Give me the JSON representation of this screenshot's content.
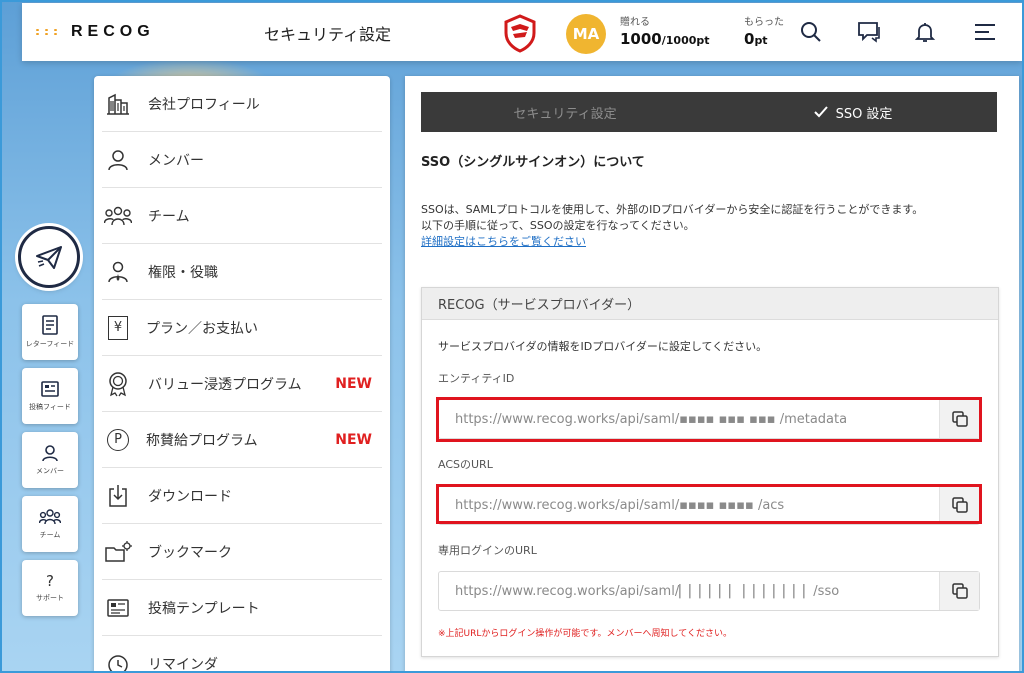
{
  "header": {
    "logo_text": "RECOG",
    "title": "セキュリティ設定",
    "avatar_initials": "MA",
    "give": {
      "label": "贈れる",
      "value": "1000",
      "suffix": "/1000pt"
    },
    "receive": {
      "label": "もらった",
      "value": "0",
      "suffix": "pt"
    }
  },
  "rail": {
    "letter_feed": "レターフィード",
    "post_feed": "投稿フィード",
    "member": "メンバー",
    "team": "チーム",
    "support": "サポート",
    "support_glyph": "?"
  },
  "menu": {
    "items": [
      {
        "label": "会社プロフィール",
        "icon": "building-icon"
      },
      {
        "label": "メンバー",
        "icon": "person-icon"
      },
      {
        "label": "チーム",
        "icon": "team-icon"
      },
      {
        "label": "権限・役職",
        "icon": "role-icon"
      },
      {
        "label": "プラン／お支払い",
        "icon": "yen-icon"
      },
      {
        "label": "バリュー浸透プログラム",
        "icon": "badge-icon",
        "badge": "NEW"
      },
      {
        "label": "称賛給プログラム",
        "icon": "p-coin-icon",
        "badge": "NEW"
      },
      {
        "label": "ダウンロード",
        "icon": "download-icon"
      },
      {
        "label": "ブックマーク",
        "icon": "bookmark-folder-icon"
      },
      {
        "label": "投稿テンプレート",
        "icon": "template-icon"
      },
      {
        "label": "リマインダ",
        "icon": "clock-icon"
      }
    ],
    "p_glyph": "P",
    "yen_glyph": "¥"
  },
  "tabs": [
    {
      "label": "セキュリティ設定",
      "active": false
    },
    {
      "label": "SSO 設定",
      "active": true
    }
  ],
  "sso": {
    "title": "SSO（シングルサインオン）について",
    "desc_line1": "SSOは、SAMLプロトコルを使用して、外部のIDプロバイダーから安全に認証を行うことができます。",
    "desc_line2": "以下の手順に従って、SSOの設定を行なってください。",
    "detail_link": "詳細設定はこちらをご覧ください"
  },
  "provider": {
    "title": "RECOG（サービスプロバイダー）",
    "intro": "サービスプロバイダの情報をIDプロバイダーに設定してください。",
    "fields": [
      {
        "label": "エンティティID",
        "value": "https://www.recog.works/api/saml/▪▪▪▪ ▪▪▪ ▪▪▪   /metadata",
        "highlighted": true
      },
      {
        "label": "ACSのURL",
        "value": "https://www.recog.works/api/saml/▪▪▪▪  ▪▪▪▪  /acs",
        "highlighted": true
      },
      {
        "label": "専用ログインのURL",
        "value": "https://www.recog.works/api/saml/▏▏▏▏▏▏   ▏▏▏▏▏▏▏/sso",
        "highlighted": false
      }
    ],
    "note": "※上記URLからログイン操作が可能です。メンバーへ周知してください。"
  },
  "colors": {
    "accent_red": "#e0141e",
    "new_badge": "#e02020",
    "tab_bar": "#3a3a3a",
    "avatar": "#f0b530",
    "link": "#1f6fc5"
  }
}
